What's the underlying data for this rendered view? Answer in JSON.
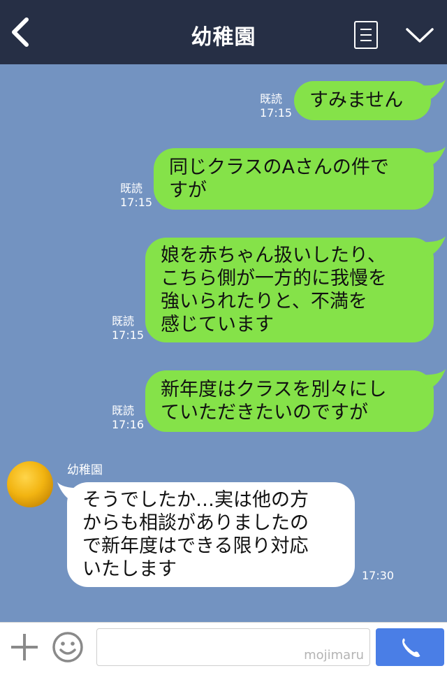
{
  "header": {
    "title": "幼稚園",
    "back_icon": "chevron-left-icon",
    "menu_icon": "note-menu-icon",
    "expand_icon": "chevron-down-icon"
  },
  "messages": [
    {
      "side": "sent",
      "text": "すみません",
      "read": "既読",
      "time": "17:15"
    },
    {
      "side": "sent",
      "text": "同じクラスのAさんの件で\nすが",
      "read": "既読",
      "time": "17:15"
    },
    {
      "side": "sent",
      "text": "娘を赤ちゃん扱いしたり、\nこちら側が一方的に我慢を\n強いられたりと、不満を\n感じています",
      "read": "既読",
      "time": "17:15"
    },
    {
      "side": "sent",
      "text": "新年度はクラスを別々にし\nていただきたいのですが",
      "read": "既読",
      "time": "17:16"
    },
    {
      "side": "received",
      "sender": "幼稚園",
      "text": "そうでしたか…実は他の方\nからも相談がありましたの\nで新年度はできる限り対応\nいたします",
      "time": "17:30"
    }
  ],
  "input": {
    "placeholder": "",
    "watermark": "mojimaru",
    "plus_icon": "plus-icon",
    "emoji_icon": "smiley-icon",
    "call_icon": "phone-icon"
  },
  "colors": {
    "header_bg": "#262f45",
    "chat_bg": "#7393c1",
    "sent_bubble": "#85e249",
    "received_bubble": "#ffffff",
    "call_button": "#4a7ee6"
  }
}
